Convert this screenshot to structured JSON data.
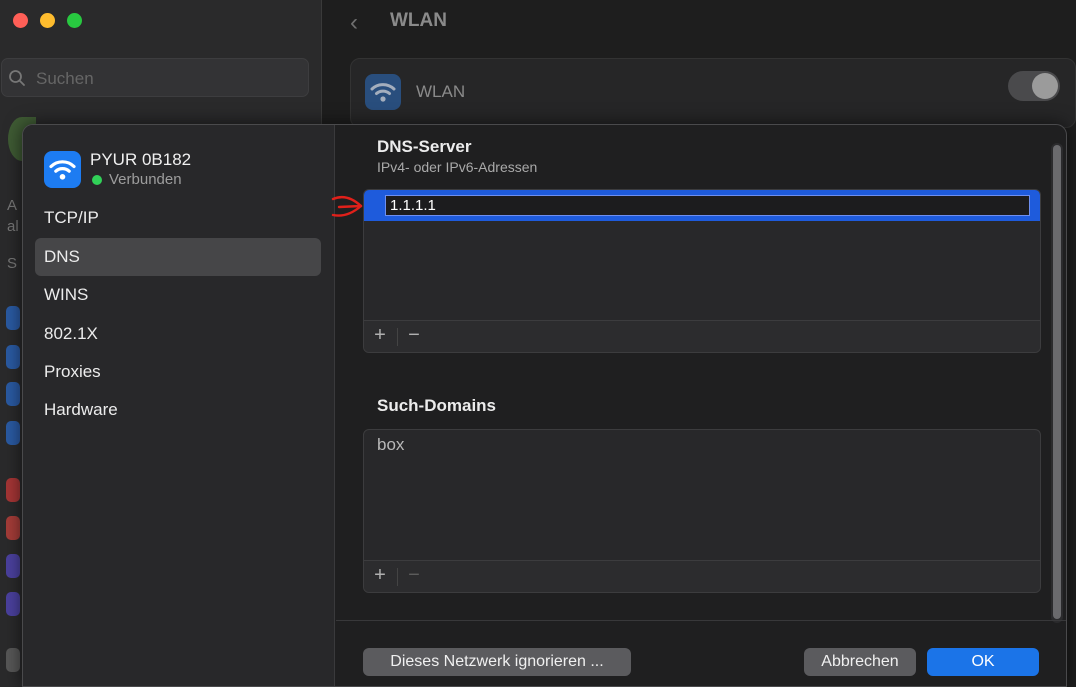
{
  "background": {
    "search_placeholder": "Suchen",
    "header_title": "WLAN",
    "wlan_label": "WLAN",
    "peek_texts": [
      "A",
      "al",
      "S"
    ]
  },
  "sheet": {
    "network_name": "PYUR 0B182",
    "network_status": "Verbunden",
    "nav_items": [
      "TCP/IP",
      "DNS",
      "WINS",
      "802.1X",
      "Proxies",
      "Hardware"
    ],
    "active_nav": "DNS",
    "dns": {
      "title": "DNS-Server",
      "subtitle": "IPv4- oder IPv6-Adressen",
      "servers": [
        "1.1.1.1"
      ],
      "add_label": "+",
      "remove_label": "−"
    },
    "search_domains": {
      "title": "Such-Domains",
      "domains": [
        "box"
      ],
      "add_label": "+",
      "remove_label": "−"
    },
    "buttons": {
      "ignore": "Dieses Netzwerk ignorieren ...",
      "cancel": "Abbrechen",
      "ok": "OK"
    }
  },
  "colors": {
    "accent": "#1b74e8",
    "selection": "#1e5bdc",
    "connected": "#31d158",
    "annotation_arrow": "#e0201a"
  }
}
